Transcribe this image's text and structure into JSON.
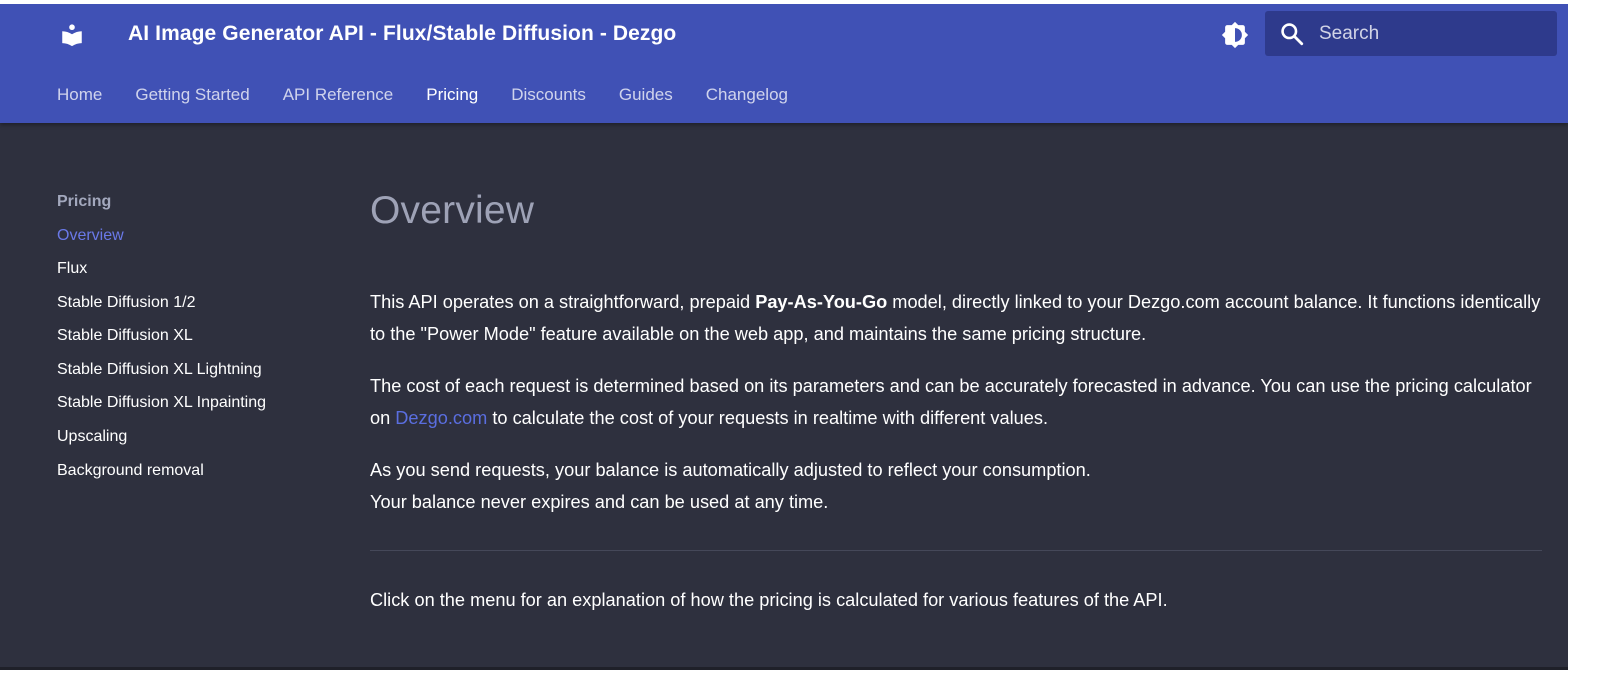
{
  "header": {
    "site_title": "AI Image Generator API - Flux/Stable Diffusion - Dezgo",
    "logo_icon": "book-open-icon",
    "palette_icon": "brightness-toggle-icon",
    "search": {
      "placeholder": "Search",
      "value": "",
      "icon": "search-icon"
    }
  },
  "tabs": [
    {
      "label": "Home",
      "active": false
    },
    {
      "label": "Getting Started",
      "active": false
    },
    {
      "label": "API Reference",
      "active": false
    },
    {
      "label": "Pricing",
      "active": true
    },
    {
      "label": "Discounts",
      "active": false
    },
    {
      "label": "Guides",
      "active": false
    },
    {
      "label": "Changelog",
      "active": false
    }
  ],
  "sidebar": {
    "section_title": "Pricing",
    "items": [
      {
        "label": "Overview",
        "active": true
      },
      {
        "label": "Flux"
      },
      {
        "label": "Stable Diffusion 1/2"
      },
      {
        "label": "Stable Diffusion XL"
      },
      {
        "label": "Stable Diffusion XL Lightning"
      },
      {
        "label": "Stable Diffusion XL Inpainting"
      },
      {
        "label": "Upscaling"
      },
      {
        "label": "Background removal"
      }
    ]
  },
  "main": {
    "title": "Overview",
    "para1": {
      "before": "This API operates on a straightforward, prepaid ",
      "bold": "Pay-As-You-Go",
      "after": " model, directly linked to your Dezgo.com account balance. It functions identically to the \"Power Mode\" feature available on the web app, and maintains the same pricing structure."
    },
    "para2": {
      "before": "The cost of each request is determined based on its parameters and can be accurately forecasted in advance. You can use the pricing calculator on ",
      "link": "Dezgo.com",
      "after": " to calculate the cost of your requests in realtime with different values."
    },
    "para3": {
      "line1": "As you send requests, your balance is automatically adjusted to reflect your consumption.",
      "line2": "Your balance never expires and can be used at any time."
    },
    "para4": "Click on the menu for an explanation of how the pricing is calculated for various features of the API."
  },
  "colors": {
    "header_bg": "#4051b5",
    "page_bg": "#2e303e",
    "accent_link": "#5a6ee0"
  }
}
